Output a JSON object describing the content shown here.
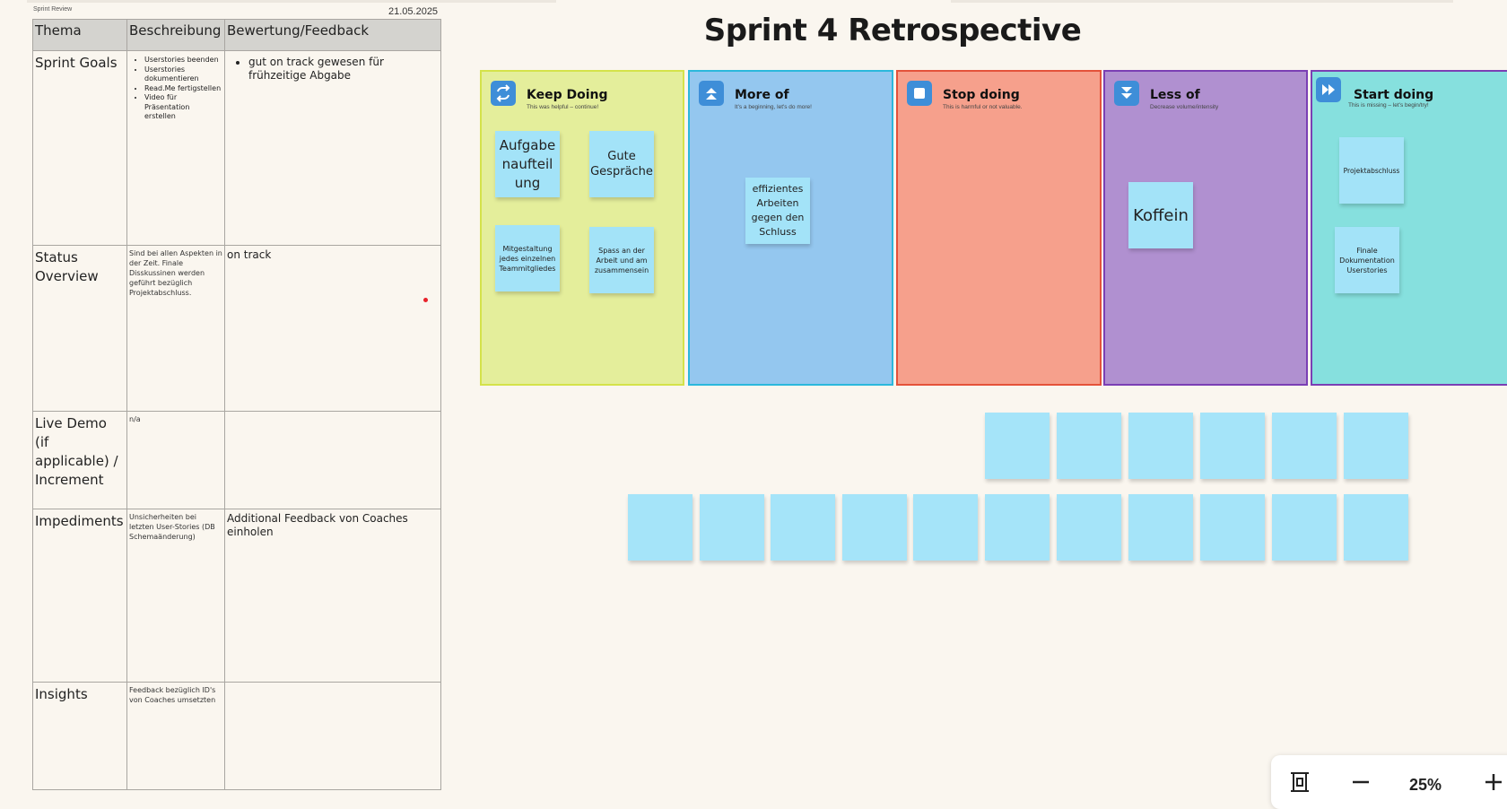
{
  "review": {
    "doc_label": "Sprint Review",
    "date": "21.05.2025",
    "headers": [
      "Thema",
      "Beschreibung",
      "Bewertung/Feedback"
    ],
    "rows": [
      {
        "topic": "Sprint Goals",
        "desc_items": [
          "Userstories beenden",
          "Userstories dokumentieren",
          "Read.Me fertigstellen",
          "Video für Präsentation erstellen"
        ],
        "feedback_items": [
          "gut on track gewesen für frühzeitige Abgabe"
        ]
      },
      {
        "topic": "Status Overview",
        "desc": "Sind bei allen Aspekten in der Zeit. Finale Disskussinen werden geführt bezüglich Projektabschluss.",
        "feedback": "on track"
      },
      {
        "topic": "Live Demo (if applicable) / Increment",
        "desc": "n/a",
        "feedback": ""
      },
      {
        "topic": "Impediments",
        "desc": "Unsicherheiten bei letzten User-Stories (DB Schemaänderung)",
        "feedback": "Additional Feedback von Coaches einholen"
      },
      {
        "topic": "Insights",
        "desc": "Feedback bezüglich ID's von Coaches umsetzten",
        "feedback": ""
      }
    ]
  },
  "board": {
    "title": "Sprint 4 Retrospective",
    "columns": [
      {
        "title": "Keep Doing",
        "subtitle": "This was helpful – continue!",
        "icon": "repeat-icon",
        "color": "#e4ee9b",
        "border": "#d4e24a"
      },
      {
        "title": "More of",
        "subtitle": "It's a beginning, let's do more!",
        "icon": "double-up-arrow-icon",
        "color": "#94c7ef",
        "border": "#2bb8dc"
      },
      {
        "title": "Stop doing",
        "subtitle": "This is harmful or not valuable.",
        "icon": "stop-square-icon",
        "color": "#f6a08c",
        "border": "#e4523a"
      },
      {
        "title": "Less of",
        "subtitle": "Decrease volume/intensity",
        "icon": "double-down-arrow-icon",
        "color": "#b090d0",
        "border": "#7b3fb4"
      },
      {
        "title": "Start doing",
        "subtitle": "This is missing – let's begin/try!",
        "icon": "fast-forward-icon",
        "color": "#86e0de",
        "border": "#7b3fb4"
      }
    ],
    "notes": {
      "keep_1": "Aufgabe naufteil ung",
      "keep_2": "Gute Gespräche",
      "keep_3": "Mitgestaltung jedes einzelnen Teammitgliedes",
      "keep_4": "Spass an der Arbeit und am zusammensein",
      "more_1": "effizientes Arbeiten gegen den Schluss",
      "less_1": "Koffein",
      "start_1": "Projektabschluss",
      "start_2": "Finale Dokumentation Userstories"
    },
    "blank_notes_row1": 6,
    "blank_notes_row2": 11
  },
  "zoom": {
    "level": "25%",
    "icons": [
      "fit-to-screen-icon",
      "zoom-out-icon",
      "zoom-in-icon"
    ]
  }
}
